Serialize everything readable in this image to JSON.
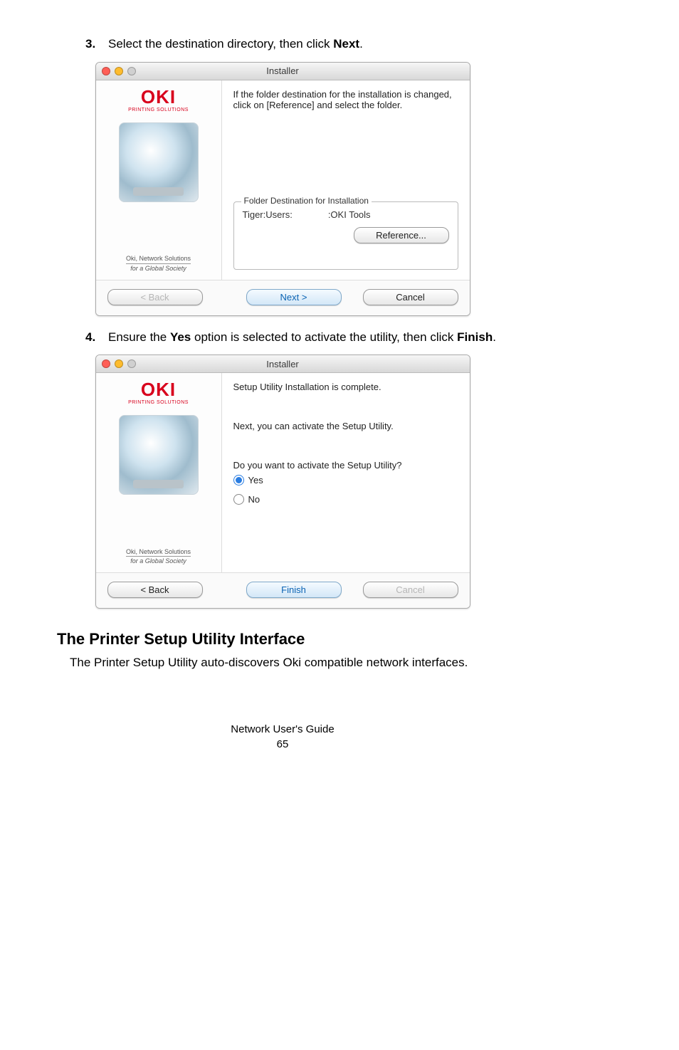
{
  "steps": {
    "s3": {
      "num": "3.",
      "text_a": "Select the destination directory, then click ",
      "bold": "Next",
      "text_b": "."
    },
    "s4": {
      "num": "4.",
      "text_a": "Ensure the ",
      "bold1": "Yes",
      "text_b": " option is selected to activate the utility, then click ",
      "bold2": "Finish",
      "text_c": "."
    }
  },
  "dialog1": {
    "title": "Installer",
    "logo": "OKI",
    "logo_tag": "PRINTING SOLUTIONS",
    "side_brand_line1": "Oki, Network Solutions",
    "side_brand_line2": "for a Global Society",
    "main_text": "If the folder destination for the installation is changed, click on [Reference] and select the folder.",
    "group_legend": "Folder Destination for Installation",
    "path_a": "Tiger:Users:",
    "path_b": ":OKI Tools",
    "ref_btn": "Reference...",
    "back_btn": "< Back",
    "next_btn": "Next >",
    "cancel_btn": "Cancel"
  },
  "dialog2": {
    "title": "Installer",
    "logo": "OKI",
    "logo_tag": "PRINTING SOLUTIONS",
    "side_brand_line1": "Oki, Network Solutions",
    "side_brand_line2": "for a Global Society",
    "line1": "Setup Utility Installation is complete.",
    "line2": "Next, you can activate the Setup Utility.",
    "line3": "Do you want to activate the Setup Utility?",
    "opt_yes": "Yes",
    "opt_no": "No",
    "back_btn": "< Back",
    "finish_btn": "Finish",
    "cancel_btn": "Cancel"
  },
  "section_heading": "The Printer Setup Utility Interface",
  "section_body": "The Printer Setup Utility auto-discovers Oki compatible network interfaces.",
  "footer_line": "Network User's Guide",
  "footer_page": "65",
  "chart_data": null
}
